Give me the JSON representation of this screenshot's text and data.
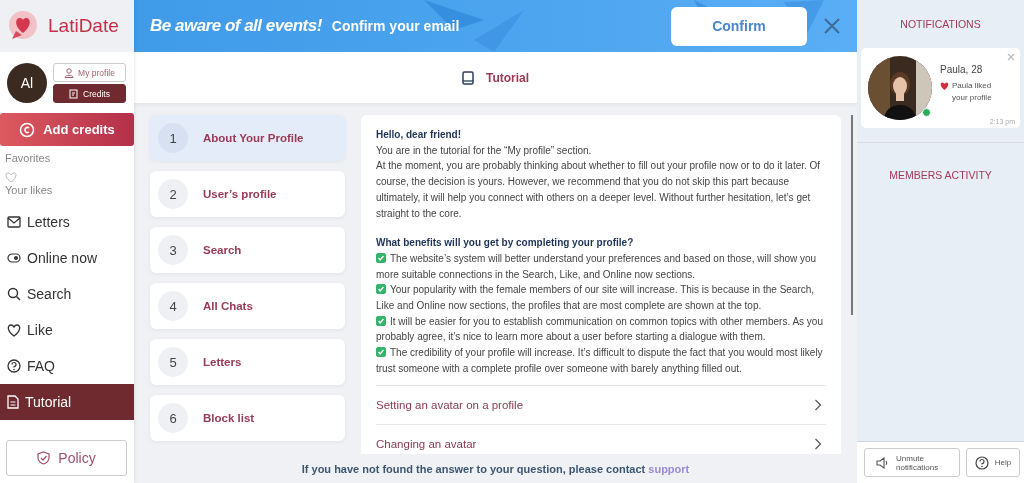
{
  "logo": {
    "text": "LatiDate"
  },
  "banner": {
    "headline": "Be aware of all events!",
    "text": "Confirm your email",
    "button": "Confirm"
  },
  "profile": {
    "initials": "Al",
    "buttons": [
      {
        "label": "My profile",
        "kind": "outline"
      },
      {
        "label": "Credits",
        "kind": "filled"
      }
    ]
  },
  "add_credits": "Add credits",
  "favorites": {
    "title": "Favorites",
    "likes": "Your likes"
  },
  "nav": [
    {
      "label": "Letters",
      "selected": false
    },
    {
      "label": "Online now",
      "selected": false
    },
    {
      "label": "Search",
      "selected": false
    },
    {
      "label": "Like",
      "selected": false
    },
    {
      "label": "FAQ",
      "selected": false
    },
    {
      "label": "Tutorial",
      "selected": true
    }
  ],
  "policy": "Policy",
  "page_title": "Tutorial",
  "topics": [
    {
      "number": "1",
      "label": "About Your Profile",
      "selected": true
    },
    {
      "number": "2",
      "label": "User’s profile",
      "selected": false
    },
    {
      "number": "3",
      "label": "Search",
      "selected": false
    },
    {
      "number": "4",
      "label": "All Chats",
      "selected": false
    },
    {
      "number": "5",
      "label": "Letters",
      "selected": false
    },
    {
      "number": "6",
      "label": "Block list",
      "selected": false
    }
  ],
  "article": {
    "greeting": "Hello, dear friend!",
    "paragraphs": [
      "You are in the tutorial for the “My profile” section.",
      "At the moment, you are probably thinking about whether to fill out your profile now or to do it later. Of course, the decision is yours. However, we recommend that you do not skip this part because ultimately, it will help you connect with others on a deeper level. Without further hesitation, let’s get straight to the core."
    ],
    "benefits_title": "What benefits will you get by completing your profile?",
    "benefits": [
      {
        "text": "The website’s system will better understand your preferences and based on those, will show you more suitable connections in the Search, Like, and Online now sections.",
        "checked": true
      },
      {
        "text": "Your popularity with the female members of our site will increase. This is because in the Search, Like and Online now sections, the profiles that are most complete are shown at the top.",
        "checked": true
      },
      {
        "text": "It will be easier for you to establish communication on common topics with other members. As you probably agree, it’s nice to learn more about a user before starting a dialogue with them.",
        "checked": true
      },
      {
        "text": "The credibility of your profile will increase. It’s difficult to dispute the fact that you would most likely trust someone with a complete profile over someone with barely anything filled out.",
        "checked": true
      }
    ],
    "sections": [
      "Setting an avatar on a profile",
      "Changing an avatar"
    ]
  },
  "footer": {
    "text": "If you have not found the answer to your question, please contact",
    "link": "support"
  },
  "notifications": {
    "title": "NOTIFICATIONS",
    "items": [
      {
        "name": "Paula, 28",
        "message": "Paula liked your profile",
        "time": "2:13 pm",
        "online": true
      }
    ]
  },
  "members_activity": {
    "title": "MEMBERS ACTIVITY"
  },
  "bottom_buttons": [
    {
      "label": "Unmute notifications",
      "kind": "sound"
    },
    {
      "label": "Help",
      "kind": "help"
    }
  ]
}
